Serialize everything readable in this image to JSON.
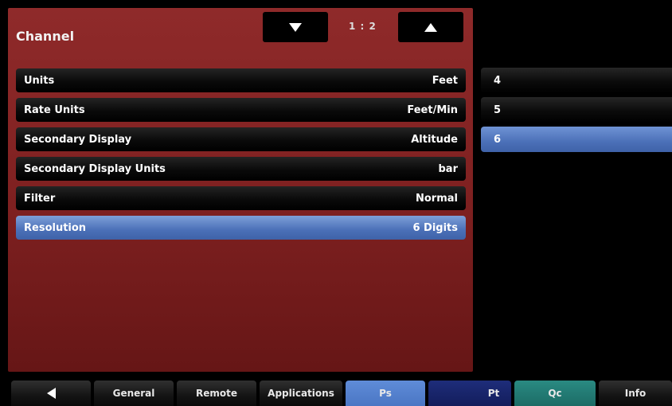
{
  "header": {
    "title": "Channel",
    "page_indicator": "1 : 2",
    "down_icon": "triangle-down",
    "up_icon": "triangle-up"
  },
  "settings": [
    {
      "label": "Units",
      "value": "Feet",
      "selected": false
    },
    {
      "label": "Rate Units",
      "value": "Feet/Min",
      "selected": false
    },
    {
      "label": "Secondary Display",
      "value": "Altitude",
      "selected": false
    },
    {
      "label": "Secondary Display Units",
      "value": "bar",
      "selected": false
    },
    {
      "label": "Filter",
      "value": "Normal",
      "selected": false
    },
    {
      "label": "Resolution",
      "value": "6 Digits",
      "selected": true
    }
  ],
  "options": [
    {
      "label": "4",
      "selected": false
    },
    {
      "label": "5",
      "selected": false
    },
    {
      "label": "6",
      "selected": true
    }
  ],
  "tabs": [
    {
      "label": "",
      "icon": "triangle-left"
    },
    {
      "label": "General"
    },
    {
      "label": "Remote"
    },
    {
      "label": "Applications"
    },
    {
      "label": "Ps",
      "color": "#4a76c4"
    },
    {
      "label": "Pt",
      "color": "#131d5c"
    },
    {
      "label": "Qc",
      "color": "#1c6c66"
    },
    {
      "label": "Info"
    }
  ],
  "colors": {
    "panel": "#7e2020",
    "selected": "#4b70b8"
  }
}
